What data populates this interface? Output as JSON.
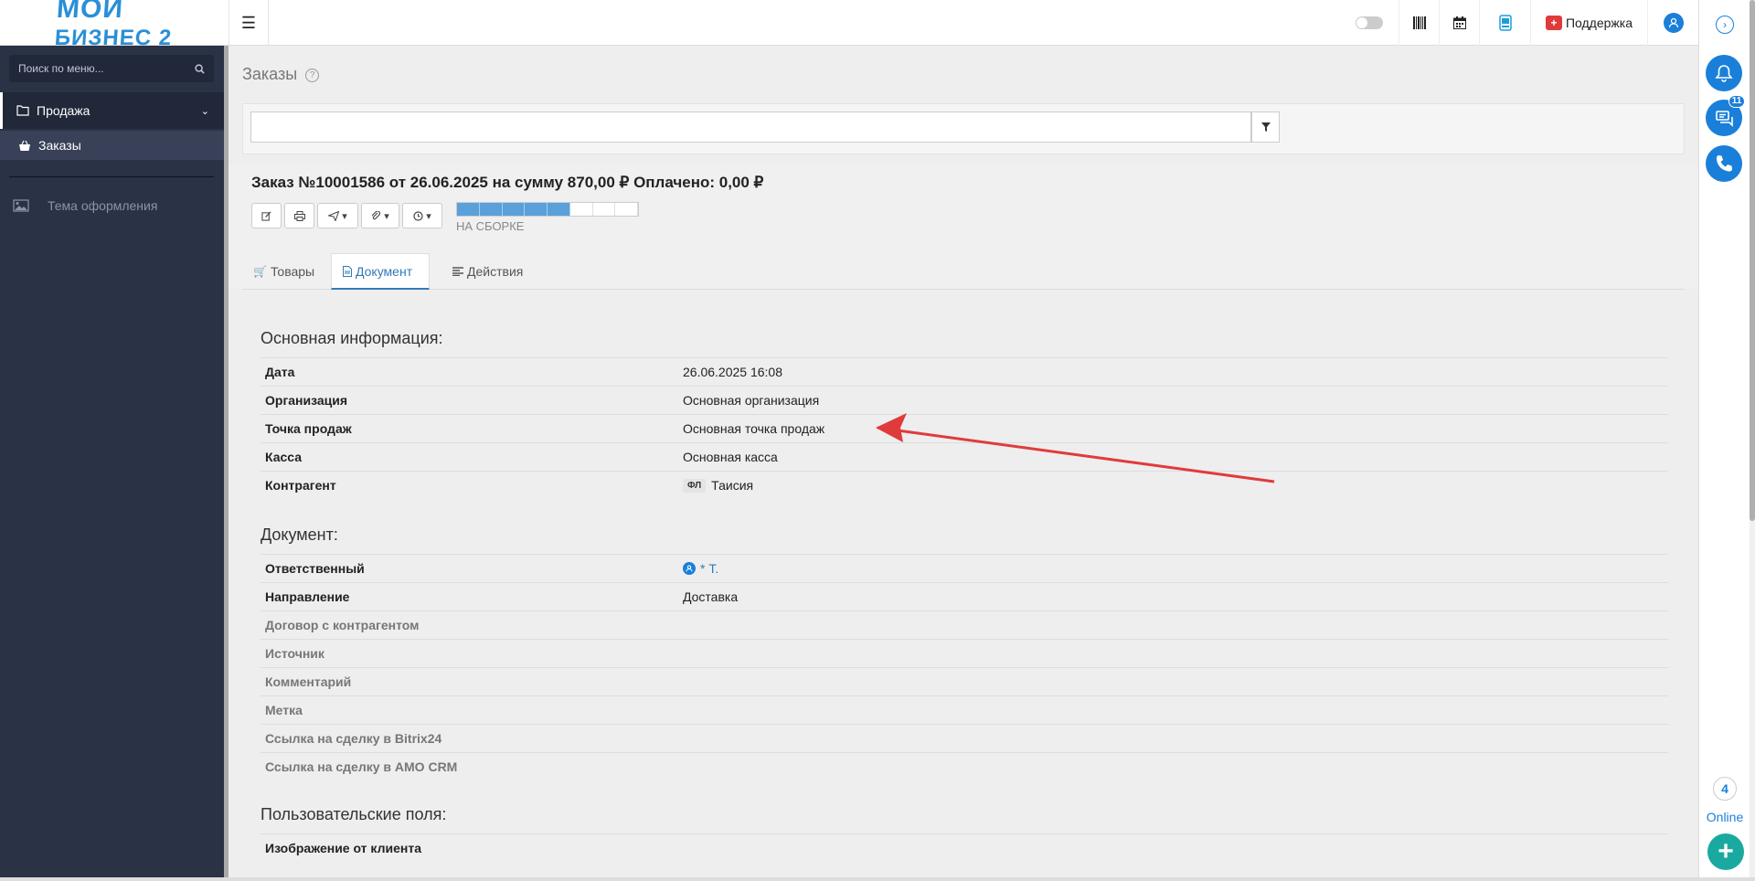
{
  "logo": {
    "line1": "МОЙ",
    "line2": "БИЗНЕС 2"
  },
  "topbar": {
    "support_label": "Поддержка"
  },
  "sidebar": {
    "search_placeholder": "Поиск по меню...",
    "sale_label": "Продажа",
    "orders_label": "Заказы",
    "theme_label": "Тема оформления"
  },
  "page": {
    "title": "Заказы"
  },
  "order": {
    "title": "Заказ №10001586 от 26.06.2025 на сумму 870,00 ₽ Оплачено: 0,00 ₽",
    "status": "НА СБОРКЕ",
    "progress_fraction": 0.625
  },
  "tabs": {
    "goods": "Товары",
    "document": "Документ",
    "actions": "Действия"
  },
  "sections": {
    "main_info": "Основная информация:",
    "document": "Документ:",
    "custom_fields": "Пользовательские поля:"
  },
  "main_info": {
    "date_key": "Дата",
    "date_val": "26.06.2025 16:08",
    "org_key": "Организация",
    "org_val": "Основная организация",
    "pos_key": "Точка продаж",
    "pos_val": "Основная точка продаж",
    "cash_key": "Касса",
    "cash_val": "Основная касса",
    "cp_key": "Контрагент",
    "cp_badge": "ФЛ",
    "cp_val": "Таисия"
  },
  "doc_info": {
    "resp_key": "Ответственный",
    "resp_val": "* Т.",
    "dir_key": "Направление",
    "dir_val": "Доставка",
    "contract_key": "Договор с контрагентом",
    "source_key": "Источник",
    "comment_key": "Комментарий",
    "tag_key": "Метка",
    "bitrix_key": "Ссылка на сделку в Bitrix24",
    "amo_key": "Ссылка на сделку в AMO CRM"
  },
  "custom": {
    "image_key": "Изображение от клиента"
  },
  "right_panel": {
    "badge": "11",
    "online_count": "4",
    "online_label": "Online",
    "add": "+"
  },
  "colors": {
    "accent": "#1a7fd9",
    "sidebar": "#2a3246",
    "annotation_arrow": "#e03b3b",
    "add": "#19a9a0"
  }
}
